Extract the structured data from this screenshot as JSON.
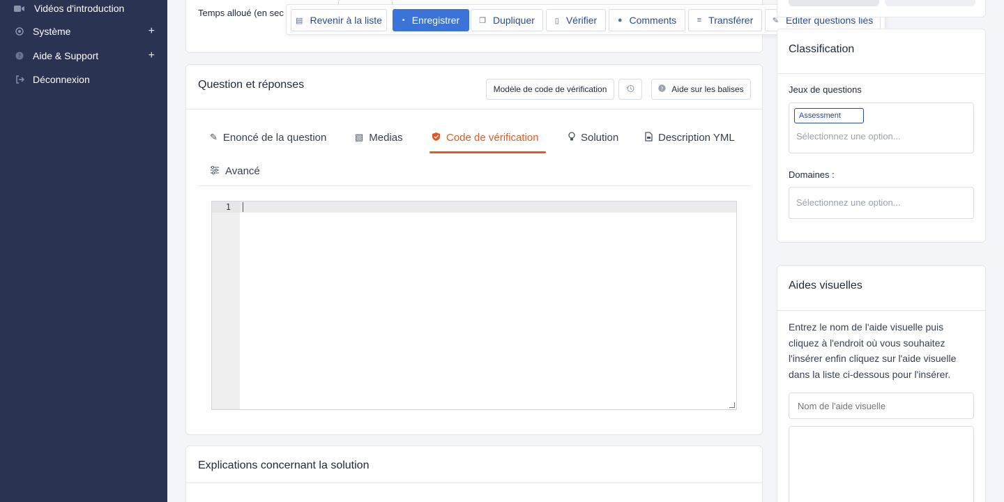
{
  "sidebar": {
    "items": [
      {
        "label": "Vidéos d'introduction",
        "icon": "video-icon",
        "expandable": false
      },
      {
        "label": "Système",
        "icon": "system-icon",
        "expandable": true
      },
      {
        "label": "Aide & Support",
        "icon": "help-icon",
        "expandable": true
      },
      {
        "label": "Déconnexion",
        "icon": "logout-icon",
        "expandable": false
      }
    ],
    "expand_symbol": "+"
  },
  "top_card": {
    "time_label": "Temps alloué (en sec"
  },
  "toolbar": {
    "buttons": [
      {
        "label": "Revenir à la liste",
        "icon": "list-icon"
      },
      {
        "label": "Enregistrer",
        "icon": "save-icon"
      },
      {
        "label": "Dupliquer",
        "icon": "duplicate-icon"
      },
      {
        "label": "Vérifier",
        "icon": "check-file-icon"
      },
      {
        "label": "Comments",
        "icon": "comment-icon"
      },
      {
        "label": "Transférer",
        "icon": "database-icon"
      },
      {
        "label": "Editer questions liés",
        "icon": "edit-icon"
      }
    ]
  },
  "qa_card": {
    "title": "Question et réponses",
    "template_button": "Modèle de code de vérification",
    "help_button": "Aide sur les balises",
    "tabs": [
      {
        "label": "Enoncé de la question",
        "icon": "edit-icon",
        "active": false
      },
      {
        "label": "Medias",
        "icon": "image-icon",
        "active": false
      },
      {
        "label": "Code de vérification",
        "icon": "shield-icon",
        "active": true
      },
      {
        "label": "Solution",
        "icon": "bulb-icon",
        "active": false
      },
      {
        "label": "Description YML",
        "icon": "file-icon",
        "active": false
      },
      {
        "label": "Avancé",
        "icon": "sliders-icon",
        "active": false
      }
    ],
    "editor": {
      "line_number": "1"
    }
  },
  "explanations_card": {
    "title": "Explications concernant la solution"
  },
  "classification": {
    "title": "Classification",
    "sets_label": "Jeux de questions",
    "sets_tag": "Assessment",
    "sets_placeholder": "Sélectionnez une option...",
    "domains_label": "Domaines :",
    "domains_placeholder": "Sélectionnez une option..."
  },
  "visual_aids": {
    "title": "Aides visuelles",
    "description_lines": [
      "Entrez le nom de l'aide visuelle puis",
      "cliquez à l'endroit où vous souhaitez",
      "l'insérer enfin cliquez sur l'aide visuelle",
      "dans la liste ci-dessous pour l'insérer."
    ],
    "name_placeholder": "Nom de l'aide visuelle"
  },
  "colors": {
    "sidebar_bg": "#2b3353",
    "primary": "#3b73d9",
    "active_tab": "#e15a24",
    "link_text": "#2b4a9e"
  }
}
